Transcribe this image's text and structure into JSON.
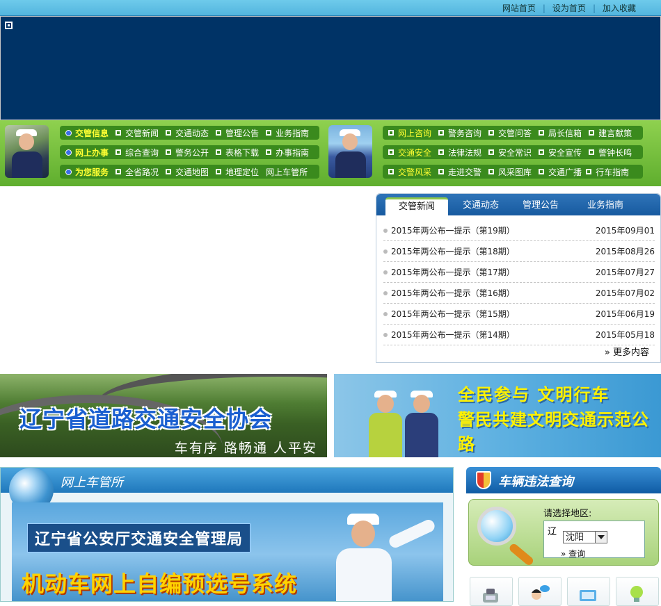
{
  "top_links": [
    "网站首页",
    "设为首页",
    "加入收藏"
  ],
  "nav": {
    "left_rows": [
      {
        "head": "交管信息",
        "items": [
          "交管新闻",
          "交通动态",
          "管理公告",
          "业务指南"
        ]
      },
      {
        "head": "网上办事",
        "items": [
          "综合查询",
          "警务公开",
          "表格下载",
          "办事指南"
        ]
      },
      {
        "head": "为您服务",
        "items": [
          "全省路况",
          "交通地图",
          "地理定位",
          "网上车管所"
        ]
      }
    ],
    "right_rows": [
      {
        "head": "网上咨询",
        "items": [
          "警务咨询",
          "交管问答",
          "局长信箱",
          "建言献策"
        ]
      },
      {
        "head": "交通安全",
        "items": [
          "法律法规",
          "安全常识",
          "安全宣传",
          "警钟长鸣"
        ]
      },
      {
        "head": "交警风采",
        "items": [
          "走进交警",
          "风采图库",
          "交通广播",
          "行车指南"
        ]
      }
    ]
  },
  "news": {
    "tabs": [
      "交管新闻",
      "交通动态",
      "管理公告",
      "业务指南"
    ],
    "active_tab": "交管新闻",
    "items": [
      {
        "title": "2015年两公布一提示（第19期）",
        "date": "2015年09月01"
      },
      {
        "title": "2015年两公布一提示（第18期）",
        "date": "2015年08月26"
      },
      {
        "title": "2015年两公布一提示（第17期）",
        "date": "2015年07月27"
      },
      {
        "title": "2015年两公布一提示（第16期）",
        "date": "2015年07月02"
      },
      {
        "title": "2015年两公布一提示（第15期）",
        "date": "2015年06月19"
      },
      {
        "title": "2015年两公布一提示（第14期）",
        "date": "2015年05月18"
      }
    ],
    "more": "» 更多内容"
  },
  "ads": {
    "left_title": "辽宁省道路交通安全协会",
    "left_slogan": "车有序 路畅通 人平安",
    "right_line1": "全民参与  文明行车",
    "right_line2": "警民共建文明交通示范公路"
  },
  "online_office": {
    "title": "网上车管所",
    "banner_label1": "辽宁省公安厅交通安全管理局",
    "banner_label2": "机动车网上自编预选号系统"
  },
  "violation": {
    "title": "车辆违法查询",
    "region_label": "请选择地区:",
    "province": "辽",
    "city_selected": "沈阳",
    "submit": "» 查询"
  },
  "colors": {
    "top_bar": "#5fc0e5",
    "banner": "#003366",
    "nav_green": "#6dbb38",
    "nav_row": "#3a8a1d",
    "nav_head_text": "#ffff33",
    "tab_bar": "#2367ac"
  },
  "icons": [
    "phone-icon",
    "person-chat-icon",
    "mail-icon",
    "bulb-icon"
  ]
}
